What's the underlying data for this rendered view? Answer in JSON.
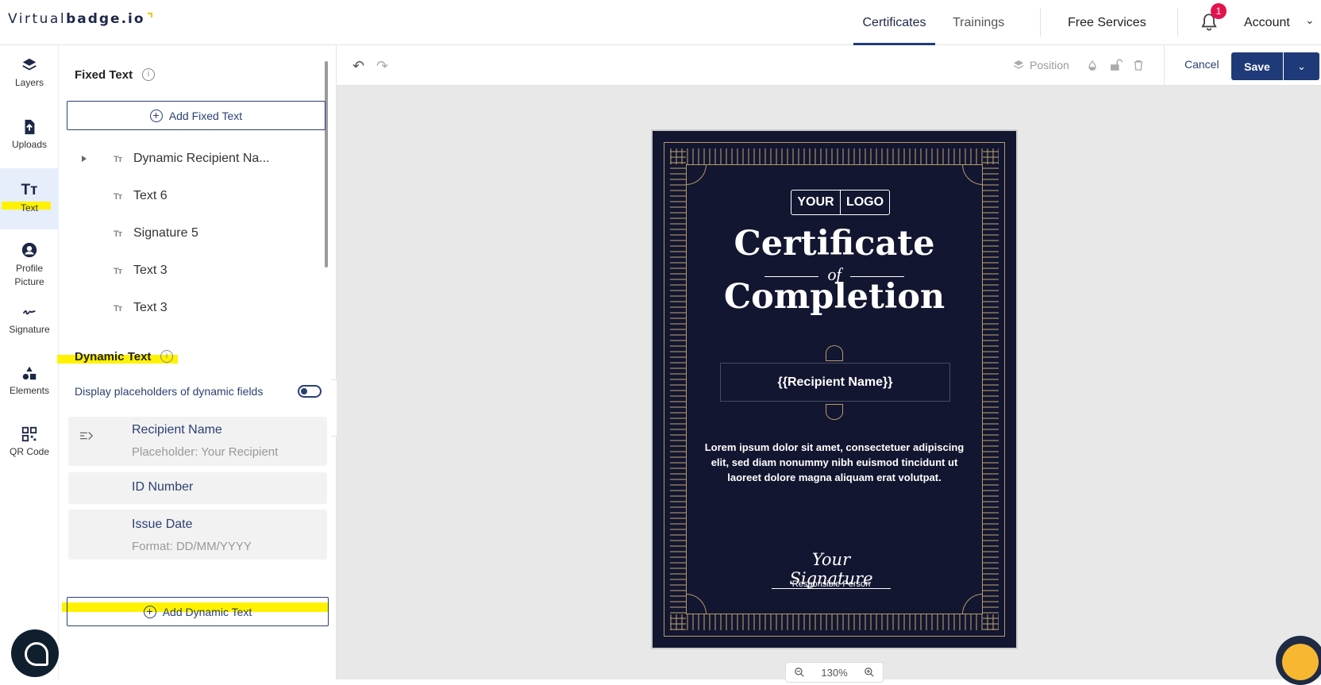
{
  "brand": {
    "part1": "Virtual",
    "part2": "badge.io"
  },
  "nav": {
    "certificates": "Certificates",
    "trainings": "Trainings",
    "free_services": "Free Services",
    "notifications_count": "1",
    "account": "Account"
  },
  "rail": {
    "items": [
      {
        "label": "Layers",
        "icon": "layers-icon"
      },
      {
        "label": "Uploads",
        "icon": "upload-icon"
      },
      {
        "label": "Text",
        "icon": "text-icon"
      },
      {
        "label": "Profile Picture",
        "icon": "profile-icon"
      },
      {
        "label": "Signature",
        "icon": "signature-icon"
      },
      {
        "label": "Elements",
        "icon": "elements-icon"
      },
      {
        "label": "QR Code",
        "icon": "qr-code-icon"
      }
    ],
    "active": "Text"
  },
  "panel": {
    "fixed_title": "Fixed Text",
    "add_fixed": "Add Fixed Text",
    "fixed_items": [
      {
        "label": "Dynamic Recipient Na...",
        "expandable": true
      },
      {
        "label": "Text 6"
      },
      {
        "label": "Signature 5"
      },
      {
        "label": "Text 3"
      },
      {
        "label": "Text 3"
      }
    ],
    "dynamic_title": "Dynamic Text",
    "toggle_label": "Display placeholders of dynamic fields",
    "dynamic_items": [
      {
        "name": "Recipient Name",
        "sub": "Placeholder: Your Recipient"
      },
      {
        "name": "ID Number",
        "sub": ""
      },
      {
        "name": "Issue Date",
        "sub": "Format: DD/MM/YYYY"
      }
    ],
    "add_dynamic": "Add Dynamic Text"
  },
  "toolbar": {
    "position": "Position",
    "cancel": "Cancel",
    "save": "Save"
  },
  "certificate": {
    "logo_left": "YOUR",
    "logo_right": "LOGO",
    "title_top": "Certificate",
    "title_of": "of",
    "title_bottom": "Completion",
    "recipient": "{{Recipient Name}}",
    "body": "Lorem ipsum dolor sit amet, consectetuer adipiscing elit, sed diam nonummy nibh euismod tincidunt ut laoreet dolore magna aliquam erat volutpat.",
    "signature": "Your Signature",
    "signature_sub": "Responsible Person",
    "colors": {
      "background": "#131630",
      "gold": "#b49b6c"
    }
  },
  "zoom": {
    "value": "130%"
  },
  "colors": {
    "primary": "#1f3a78",
    "highlight": "#fff200",
    "badge": "#e4134f"
  }
}
